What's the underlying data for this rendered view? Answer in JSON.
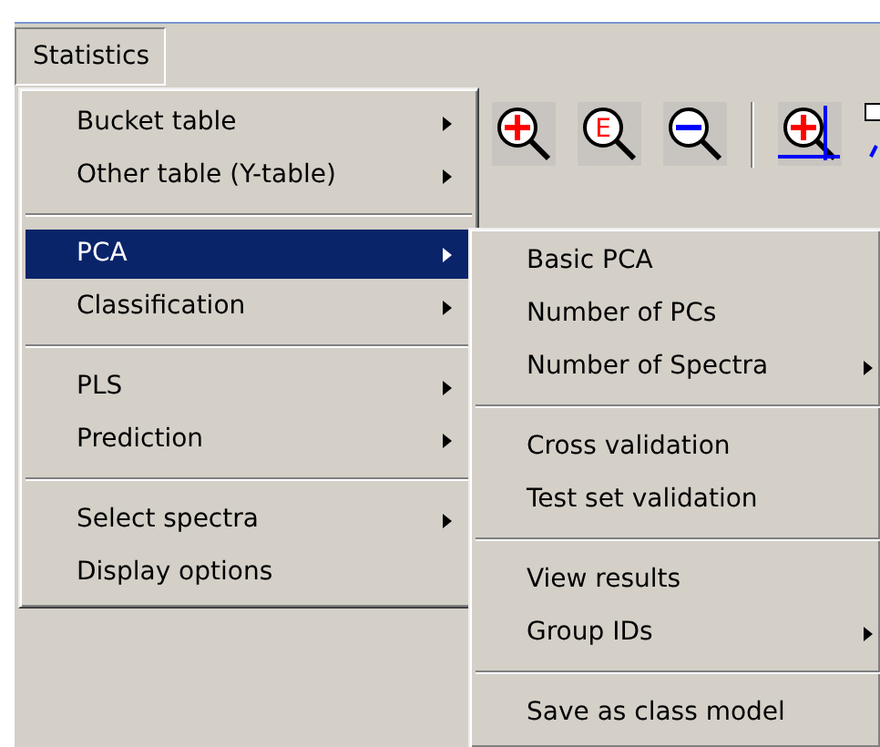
{
  "menubar": [
    {
      "label": "Statistics",
      "selected": true
    }
  ],
  "toolbar": [
    {
      "kind": "zoom-in"
    },
    {
      "kind": "zoom-letter",
      "label": "E"
    },
    {
      "kind": "zoom-out"
    },
    {
      "kind": "separator"
    },
    {
      "kind": "zoom-axis"
    },
    {
      "kind": "partial"
    }
  ],
  "menu": [
    {
      "kind": "item",
      "label": "Bucket table",
      "submenu": true,
      "selected": false
    },
    {
      "kind": "item",
      "label": "Other table (Y-table)",
      "submenu": true,
      "selected": false
    },
    {
      "kind": "separator"
    },
    {
      "kind": "item",
      "label": "PCA",
      "submenu": true,
      "selected": true
    },
    {
      "kind": "item",
      "label": "Classification",
      "submenu": true,
      "selected": false
    },
    {
      "kind": "separator"
    },
    {
      "kind": "item",
      "label": "PLS",
      "submenu": true,
      "selected": false
    },
    {
      "kind": "item",
      "label": "Prediction",
      "submenu": true,
      "selected": false
    },
    {
      "kind": "separator"
    },
    {
      "kind": "item",
      "label": "Select spectra",
      "submenu": true,
      "selected": false
    },
    {
      "kind": "item",
      "label": "Display options",
      "submenu": false,
      "selected": false
    }
  ],
  "submenu": [
    {
      "kind": "item",
      "label": "Basic PCA",
      "submenu": false,
      "selected": false
    },
    {
      "kind": "item",
      "label": "Number of PCs",
      "submenu": false,
      "selected": false
    },
    {
      "kind": "item",
      "label": "Number of Spectra",
      "submenu": true,
      "selected": false
    },
    {
      "kind": "separator"
    },
    {
      "kind": "item",
      "label": "Cross validation",
      "submenu": false,
      "selected": false
    },
    {
      "kind": "item",
      "label": "Test set validation",
      "submenu": false,
      "selected": false
    },
    {
      "kind": "separator"
    },
    {
      "kind": "item",
      "label": "View results",
      "submenu": false,
      "selected": false
    },
    {
      "kind": "item",
      "label": "Group IDs",
      "submenu": true,
      "selected": false
    },
    {
      "kind": "separator"
    },
    {
      "kind": "item",
      "label": "Save as class model",
      "submenu": false,
      "selected": false
    }
  ]
}
